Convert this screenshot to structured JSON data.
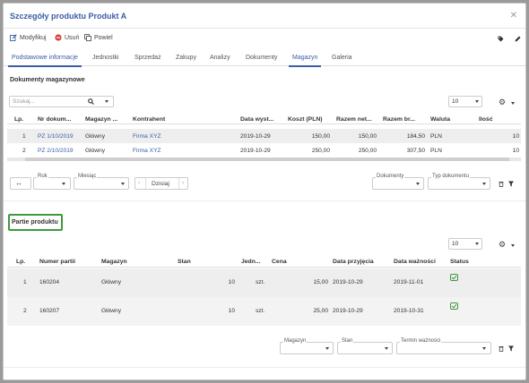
{
  "modal": {
    "title": "Szczegóły produktu Produkt A"
  },
  "toolbar": {
    "modify": "Modyfikuj",
    "delete": "Usuń",
    "duplicate": "Powiel"
  },
  "tabs": [
    "Podstawowe informacje",
    "Jednostki",
    "Sprzedaż",
    "Zakupy",
    "Analizy",
    "Dokumenty",
    "Magazyn",
    "Galeria"
  ],
  "active_tab": "Magazyn",
  "docs": {
    "title": "Dokumenty magazynowe",
    "search_placeholder": "Szukaj...",
    "page_size": "10",
    "columns": [
      "Lp.",
      "Nr dokum...",
      "Magazyn ...",
      "Kontrahent",
      "Data wyst...",
      "Koszt (PLN)",
      "Razem net...",
      "Razem br...",
      "Waluta",
      "Ilość"
    ],
    "rows": [
      {
        "lp": "1",
        "nr": "PZ 1/10/2019",
        "magazyn": "Główny",
        "kontrahent": "Firma XYZ",
        "data": "2019-10-29",
        "koszt": "150,00",
        "netto": "150,00",
        "brutto": "184,50",
        "waluta": "PLN",
        "ilosc": "10"
      },
      {
        "lp": "2",
        "nr": "PZ 2/10/2019",
        "magazyn": "Główny",
        "kontrahent": "Firma XYZ",
        "data": "2019-10-29",
        "koszt": "250,00",
        "netto": "250,00",
        "brutto": "307,50",
        "waluta": "PLN",
        "ilosc": "10"
      }
    ],
    "filters": {
      "rok": "Rok",
      "miesiac": "Miesiąc",
      "today": "Dzisiaj",
      "dokumenty": "Dokumenty",
      "typ": "Typ dokumentu"
    }
  },
  "batches": {
    "title": "Partie produktu",
    "page_size": "10",
    "columns": [
      "Lp.",
      "Numer partii",
      "Magazyn",
      "Stan",
      "Jedn...",
      "Cena",
      "Data przyjęcia",
      "Data ważności",
      "Status"
    ],
    "rows": [
      {
        "lp": "1",
        "numer": "160204",
        "magazyn": "Główny",
        "stan": "10",
        "jedn": "szt.",
        "cena": "15,00",
        "przyjecie": "2019-10-29",
        "waznosc": "2019-11-01"
      },
      {
        "lp": "2",
        "numer": "160207",
        "magazyn": "Główny",
        "stan": "10",
        "jedn": "szt.",
        "cena": "25,00",
        "przyjecie": "2019-10-29",
        "waznosc": "2019-10-31"
      }
    ],
    "filters": {
      "magazyn": "Magazyn",
      "stan": "Stan",
      "termin": "Termin ważności"
    }
  },
  "colors": {
    "accent": "#3a5da8",
    "status_ok": "#3c9a3c",
    "highlight": "#3c9a3c"
  }
}
